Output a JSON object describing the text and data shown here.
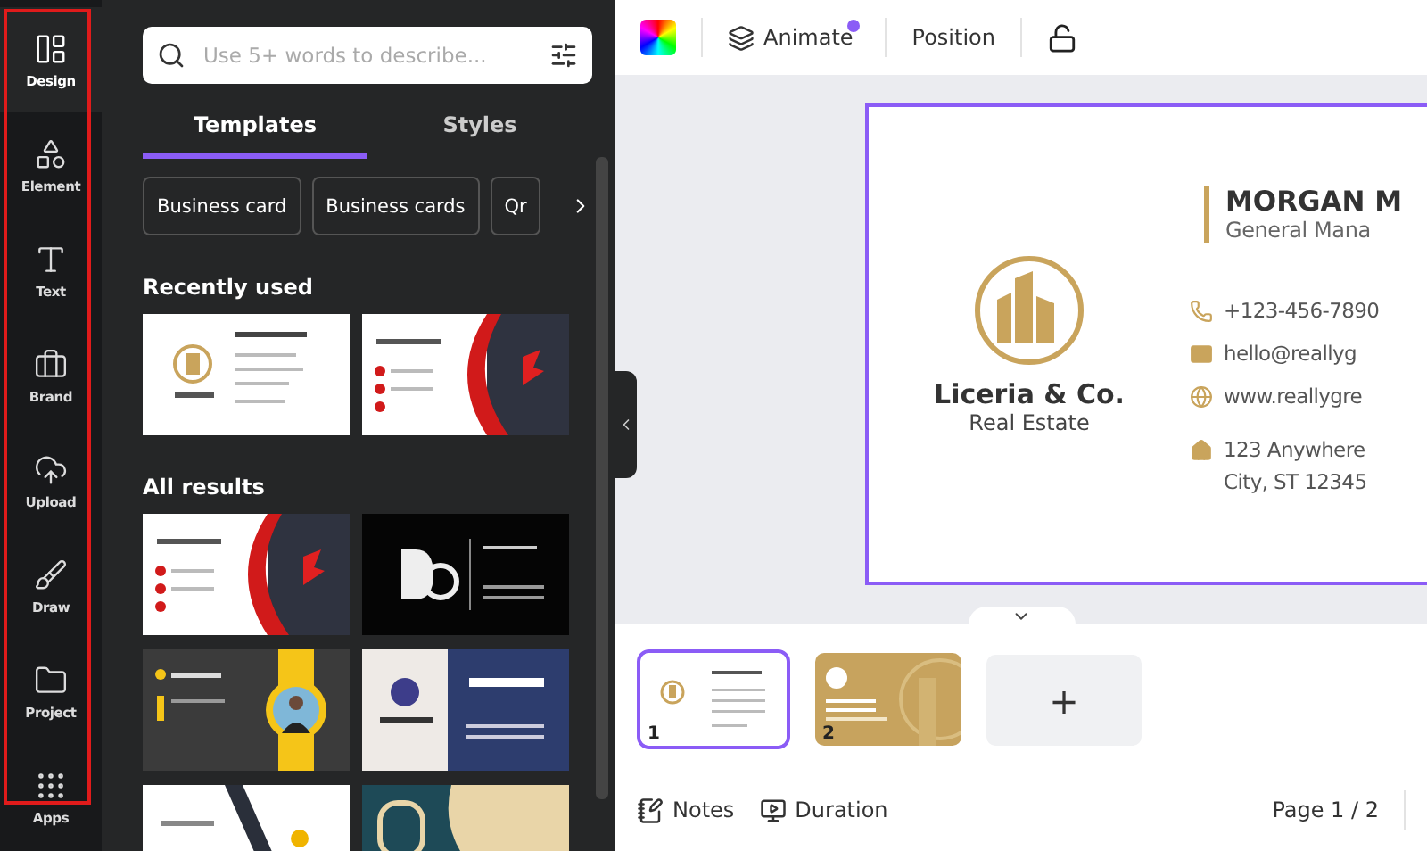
{
  "rail": [
    {
      "label": "Design",
      "selected": true
    },
    {
      "label": "Element",
      "selected": false
    },
    {
      "label": "Text",
      "selected": false
    },
    {
      "label": "Brand",
      "selected": false
    },
    {
      "label": "Upload",
      "selected": false
    },
    {
      "label": "Draw",
      "selected": false
    },
    {
      "label": "Project",
      "selected": false
    },
    {
      "label": "Apps",
      "selected": false
    }
  ],
  "search": {
    "placeholder": "Use 5+ words to describe..."
  },
  "tabs": [
    {
      "label": "Templates",
      "selected": true
    },
    {
      "label": "Styles",
      "selected": false
    }
  ],
  "chips": [
    "Business card",
    "Business cards",
    "Qr"
  ],
  "recent": {
    "title": "Recently used"
  },
  "results": {
    "title": "All results"
  },
  "toolbar": {
    "animate": "Animate",
    "animate_badge": true,
    "position": "Position"
  },
  "card": {
    "company": "Liceria & Co.",
    "tagline": "Real Estate",
    "name": "MORGAN M",
    "role": "General Mana",
    "contacts": [
      {
        "kind": "phone",
        "text": "+123-456-7890"
      },
      {
        "kind": "mail",
        "text": "hello@reallyg"
      },
      {
        "kind": "web",
        "text": "www.reallygre"
      },
      {
        "kind": "home",
        "text": "123 Anywhere",
        "text2": "City, ST 12345"
      }
    ]
  },
  "pages": [
    {
      "number": "1",
      "selected": true
    },
    {
      "number": "2",
      "selected": false
    }
  ],
  "add_page": "+",
  "footer": {
    "notes": "Notes",
    "duration": "Duration",
    "page": "Page 1 / 2"
  }
}
